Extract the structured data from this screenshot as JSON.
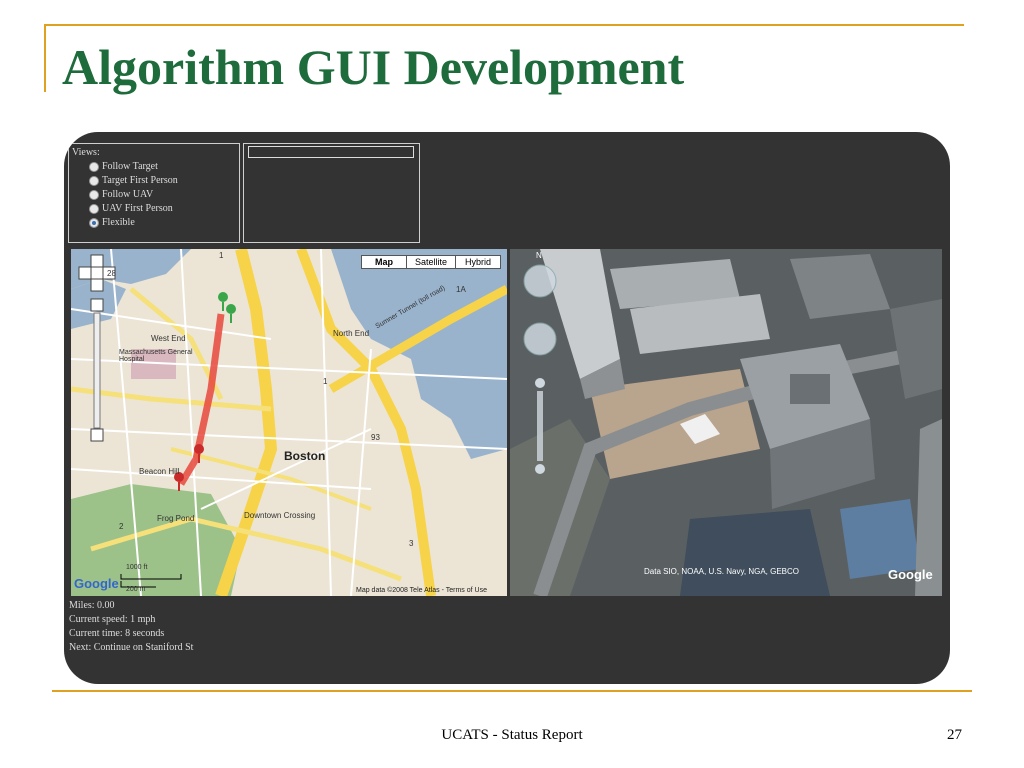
{
  "slide": {
    "title": "Algorithm GUI Development",
    "footer": "UCATS - Status Report",
    "page_number": "27"
  },
  "views_panel": {
    "label": "Views:",
    "options": [
      {
        "label": "Follow Target",
        "selected": false
      },
      {
        "label": "Target First Person",
        "selected": false
      },
      {
        "label": "Follow UAV",
        "selected": false
      },
      {
        "label": "UAV First Person",
        "selected": false
      },
      {
        "label": "Flexible",
        "selected": true
      }
    ]
  },
  "map": {
    "type_buttons": [
      "Map",
      "Satellite",
      "Hybrid"
    ],
    "active_type": "Map",
    "labels": {
      "boston": "Boston",
      "west_end": "West End",
      "north_end": "North End",
      "beacon_hill": "Beacon Hill",
      "frog_pond": "Frog Pond",
      "downtown_crossing": "Downtown Crossing",
      "mgh": "Massachusetts General Hospital",
      "big_dig": "Sumner Tunnel (toll road)"
    },
    "route_labels": {
      "2": "2",
      "1": "1",
      "3": "3",
      "1a": "1A",
      "93": "93",
      "28": "28"
    },
    "scale": {
      "feet": "1000 ft",
      "meters": "200 m"
    },
    "copyright": "Map data ©2008 Tele Atlas - Terms of Use",
    "logo": "Google"
  },
  "aerial": {
    "copyright": "Data SIO, NOAA, U.S. Navy, NGA, GEBCO",
    "logo": "Google",
    "compass_letter": "N"
  },
  "status": {
    "miles": "Miles: 0.00",
    "speed": "Current speed: 1 mph",
    "time": "Current time: 8 seconds",
    "next": "Next: Continue on Staniford St"
  },
  "colors": {
    "title_green": "#1e6b3c",
    "accent_gold": "#e0a020",
    "app_background": "#333333",
    "route_red": "#e8483c"
  }
}
